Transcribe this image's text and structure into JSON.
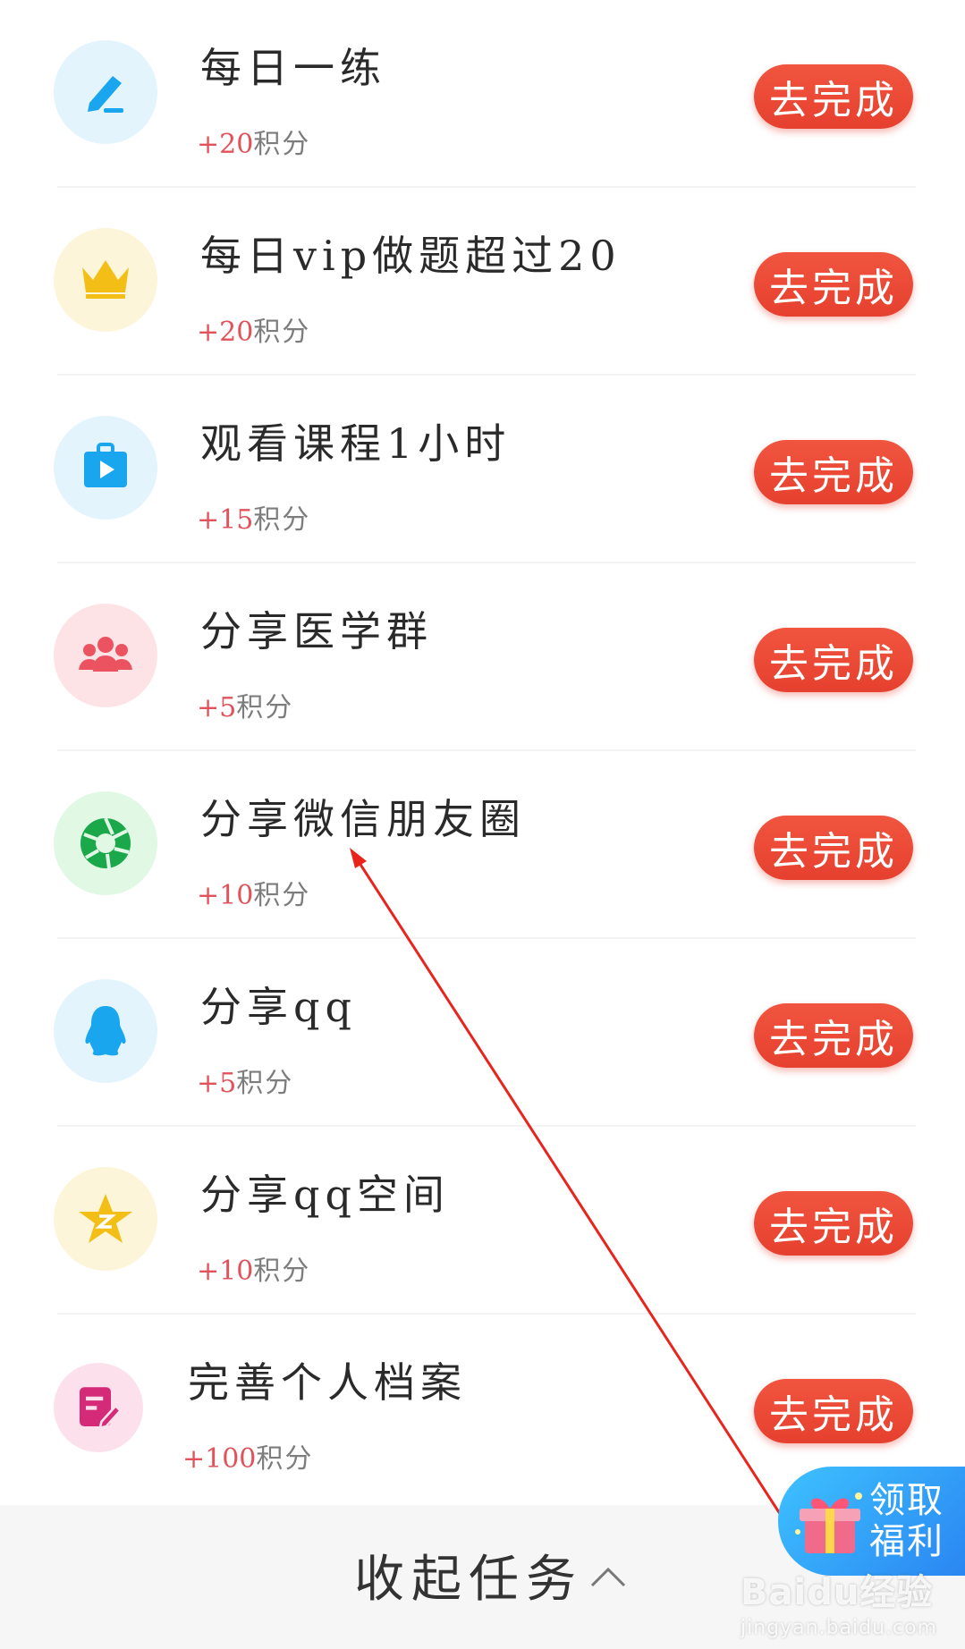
{
  "tasks": [
    {
      "title": "每日一练",
      "points": "+20",
      "unit": "积分",
      "button": "去完成",
      "icon": "pencil-icon"
    },
    {
      "title": "每日vip做题超过20",
      "points": "+20",
      "unit": "积分",
      "button": "去完成",
      "icon": "crown-icon"
    },
    {
      "title": "观看课程1小时",
      "points": "+15",
      "unit": "积分",
      "button": "去完成",
      "icon": "video-briefcase-icon"
    },
    {
      "title": "分享医学群",
      "points": "+5",
      "unit": "积分",
      "button": "去完成",
      "icon": "group-icon"
    },
    {
      "title": "分享微信朋友圈",
      "points": "+10",
      "unit": "积分",
      "button": "去完成",
      "icon": "moments-shutter-icon"
    },
    {
      "title": "分享qq",
      "points": "+5",
      "unit": "积分",
      "button": "去完成",
      "icon": "qq-penguin-icon"
    },
    {
      "title": "分享qq空间",
      "points": "+10",
      "unit": "积分",
      "button": "去完成",
      "icon": "qzone-star-icon"
    },
    {
      "title": "完善个人档案",
      "points": "+100",
      "unit": "积分",
      "button": "去完成",
      "icon": "edit-document-icon"
    }
  ],
  "footer": {
    "collapse_label": "收起任务"
  },
  "promo": {
    "line1": "领取",
    "line2": "福利"
  },
  "watermark": {
    "brand": "Baidu经验",
    "url": "jingyan.baidu.com"
  },
  "colors": {
    "button": "#e6402f",
    "points_plus": "#e2525b",
    "annotation_arrow": "#e8241c"
  }
}
